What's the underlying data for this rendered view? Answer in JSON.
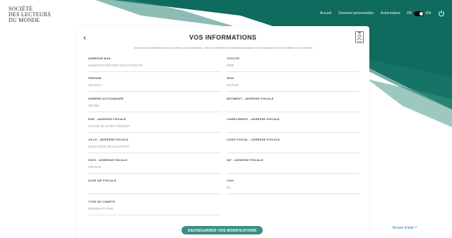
{
  "logo": {
    "line1": "SOCIÉTÉ",
    "line2": "DES LECTEURS",
    "line3": "DU MONDE"
  },
  "nav": {
    "home": "Accueil",
    "personal_data": "Données personnelles",
    "shareholders": "Actionnaires",
    "lang_fr": "FR",
    "lang_en": "EN"
  },
  "page": {
    "title": "VOS INFORMATIONS",
    "intro": "Vous êtes actuellement dans la partie vos informations, merci de vérifier les informations saisies et si nécessaire de les modifier à tout moment.",
    "save_label": "SAUVEGARDER VOS MODIFICATIONS"
  },
  "fields": {
    "email": {
      "label": "ADRESSE MAIL",
      "value": "test@ACTIONNAIRE-SOLUTIONS.FR"
    },
    "civility": {
      "label": "CIVILITE",
      "value": "MME"
    },
    "firstname": {
      "label": "PRENOM",
      "value": "JESSICA"
    },
    "lastname": {
      "label": "NOM",
      "value": "DUPUIS"
    },
    "shareholder": {
      "label": "NUMERO ACTIONNAIRE",
      "value": "001458"
    },
    "building": {
      "label": "BATIMENT - ADRESSE FISCALE",
      "value": ""
    },
    "street": {
      "label": "RUE - ADRESSE FISCALE",
      "value": "15 RUE DE SAINT VINCENT"
    },
    "complement": {
      "label": "COMPLEMENT - ADRESSE FISCALE",
      "value": ""
    },
    "city": {
      "label": "VILLE - ADRESSE FISCALE",
      "value": "BOULOGNE BILLANCOURT"
    },
    "postal": {
      "label": "CODE POSTAL - ADRESSE FISCALE",
      "value": ""
    },
    "country": {
      "label": "PAYS - ADRESSE FISCALE",
      "value": "FRANCE"
    },
    "nif": {
      "label": "NIF - ADRESSE FISCALE",
      "value": ""
    },
    "tin_date": {
      "label": "DATE NIF FISCALE",
      "value": ""
    },
    "votes": {
      "label": "VOIX",
      "value": "50"
    },
    "account_type": {
      "label": "TYPE DE COMPTE",
      "value": "NOMINATIF PUR"
    }
  },
  "help": {
    "label": "Besoin d'aide ?"
  },
  "colors": {
    "teal_dark": "#0f6b5e",
    "teal_mid": "#2e8577",
    "button": "#3b8f83",
    "help_link": "#2b7fb8"
  },
  "icons": {
    "back": "chevron-left-icon",
    "id_card": "id-card-icon",
    "power": "power-icon"
  }
}
